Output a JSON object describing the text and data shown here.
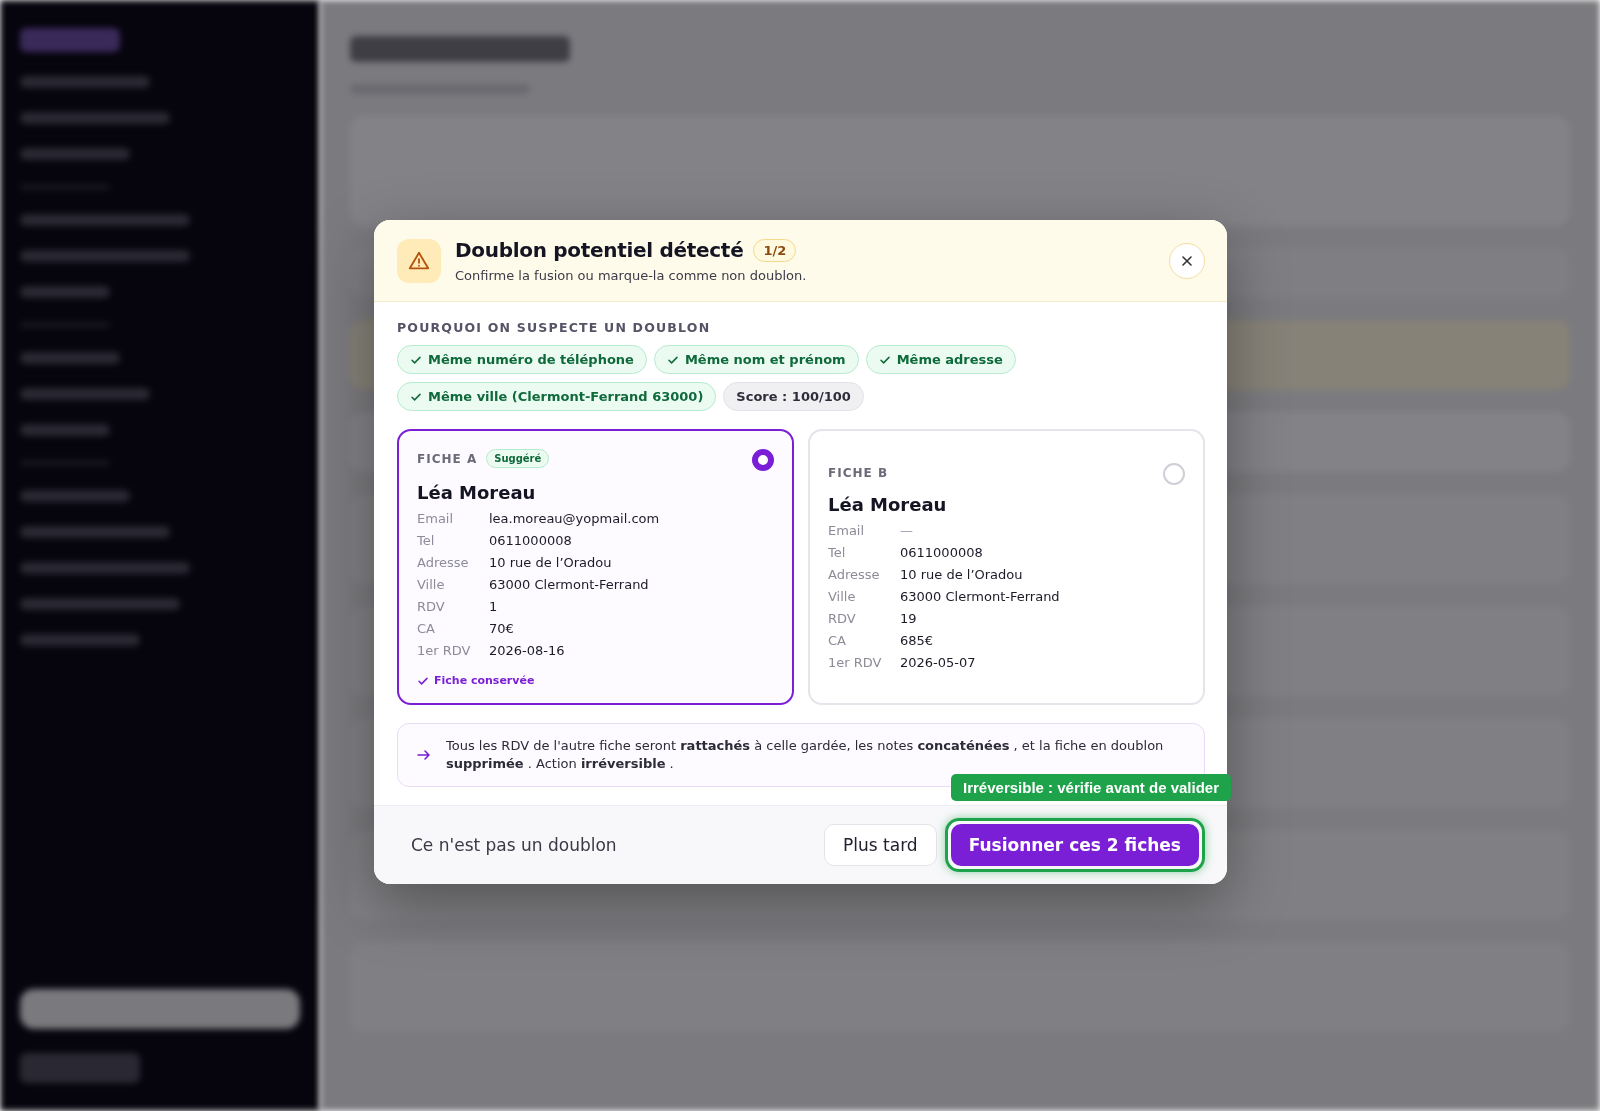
{
  "dialog": {
    "title": "Doublon potentiel détecté",
    "counter": "1/2",
    "subtitle": "Confirme la fusion ou marque-la comme non doublon.",
    "reasons_heading": "POURQUOI ON SUSPECTE UN DOUBLON",
    "reasons": [
      {
        "label": "Même numéro de téléphone",
        "kind": "match"
      },
      {
        "label": "Même nom et prénom",
        "kind": "match"
      },
      {
        "label": "Même adresse",
        "kind": "match"
      },
      {
        "label": "Même ville (Clermont-Ferrand 63000)",
        "kind": "match"
      },
      {
        "label": "Score : 100/100",
        "kind": "score"
      }
    ],
    "records": [
      {
        "heading": "FICHE A",
        "badge": "Suggéré",
        "selected": true,
        "name": "Léa Moreau",
        "fields": [
          {
            "label": "Email",
            "value": "lea.moreau@yopmail.com",
            "empty": false
          },
          {
            "label": "Tel",
            "value": "0611000008",
            "empty": false
          },
          {
            "label": "Adresse",
            "value": "10 rue de l’Oradou",
            "empty": false
          },
          {
            "label": "Ville",
            "value": "63000 Clermont-Ferrand",
            "empty": false
          },
          {
            "label": "RDV",
            "value": "1",
            "empty": false
          },
          {
            "label": "CA",
            "value": "70€",
            "empty": false
          },
          {
            "label": "1er RDV",
            "value": "2026-08-16",
            "empty": false
          }
        ],
        "kept_note": "Fiche conservée"
      },
      {
        "heading": "FICHE B",
        "selected": false,
        "name": "Léa Moreau",
        "fields": [
          {
            "label": "Email",
            "value": "—",
            "empty": true
          },
          {
            "label": "Tel",
            "value": "0611000008",
            "empty": false
          },
          {
            "label": "Adresse",
            "value": "10 rue de l’Oradou",
            "empty": false
          },
          {
            "label": "Ville",
            "value": "63000 Clermont-Ferrand",
            "empty": false
          },
          {
            "label": "RDV",
            "value": "19",
            "empty": false
          },
          {
            "label": "CA",
            "value": "685€",
            "empty": false
          },
          {
            "label": "1er RDV",
            "value": "2026-05-07",
            "empty": false
          }
        ]
      }
    ],
    "notice": "Tous les RDV de l'autre fiche seront **rattachés** à celle gardée, les notes **concaténées** , et la fiche en doublon **supprimée** . Action **irréversible** .",
    "actions": {
      "dismiss": "Ce n'est pas un doublon",
      "later": "Plus tard",
      "merge": "Fusionner ces 2 fiches",
      "merge_highlighted": true,
      "merge_tooltip": "Irréversible : vérifie avant de valider"
    }
  }
}
